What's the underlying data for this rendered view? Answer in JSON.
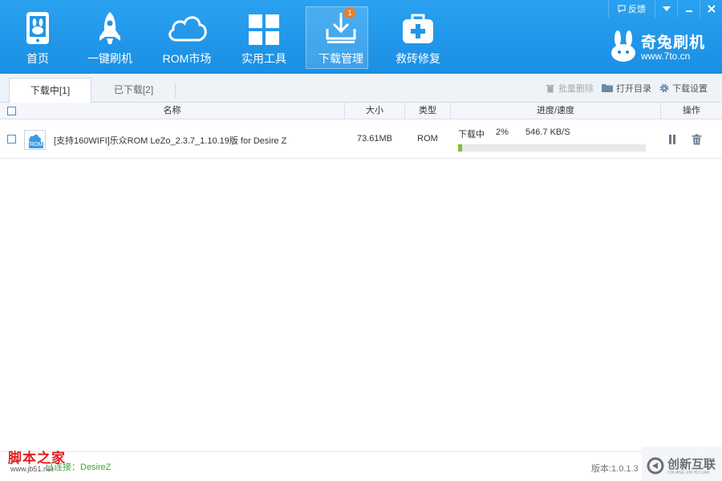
{
  "nav": {
    "items": [
      {
        "label": "首页",
        "icon": "phone-bunny-icon"
      },
      {
        "label": "一键刷机",
        "icon": "rocket-icon"
      },
      {
        "label": "ROM市场",
        "icon": "cloud-icon"
      },
      {
        "label": "实用工具",
        "icon": "grid-icon"
      },
      {
        "label": "下载管理",
        "icon": "download-tray-icon",
        "active": true,
        "badge": "1"
      },
      {
        "label": "救砖修复",
        "icon": "medkit-icon"
      }
    ]
  },
  "window": {
    "feedback": "反馈"
  },
  "brand": {
    "name": "奇兔刷机",
    "url": "www.7to.cn"
  },
  "tabs": [
    {
      "label": "下载中[1]",
      "active": true
    },
    {
      "label": "已下载[2]",
      "active": false
    }
  ],
  "actions": {
    "batch_delete": "批量删除",
    "open_dir": "打开目录",
    "settings": "下载设置"
  },
  "table": {
    "headers": {
      "name": "名称",
      "size": "大小",
      "type": "类型",
      "progress": "进度/速度",
      "ops": "操作"
    },
    "rows": [
      {
        "icon_tag": "ROM",
        "name": "[支持160WIFI]乐众ROM LeZo_2.3.7_1.10.19版 for Desire Z",
        "size": "73.61MB",
        "type": "ROM",
        "status": "下载中",
        "percent": "2%",
        "progress": 0.02,
        "speed": "546.7 KB/S"
      }
    ]
  },
  "footer": {
    "watermark_title": "脚本之家",
    "watermark_url": "www.jb51.net",
    "device_text": "已连接：DesireZ",
    "version": "版本:1.0.1.3",
    "corner_name": "创新互联",
    "corner_sub": "CHUANG XIN HU LIAN"
  },
  "colors": {
    "header": "#1b8fe3",
    "progress_fill": "#7cc23b",
    "badge": "#f07b2c"
  }
}
